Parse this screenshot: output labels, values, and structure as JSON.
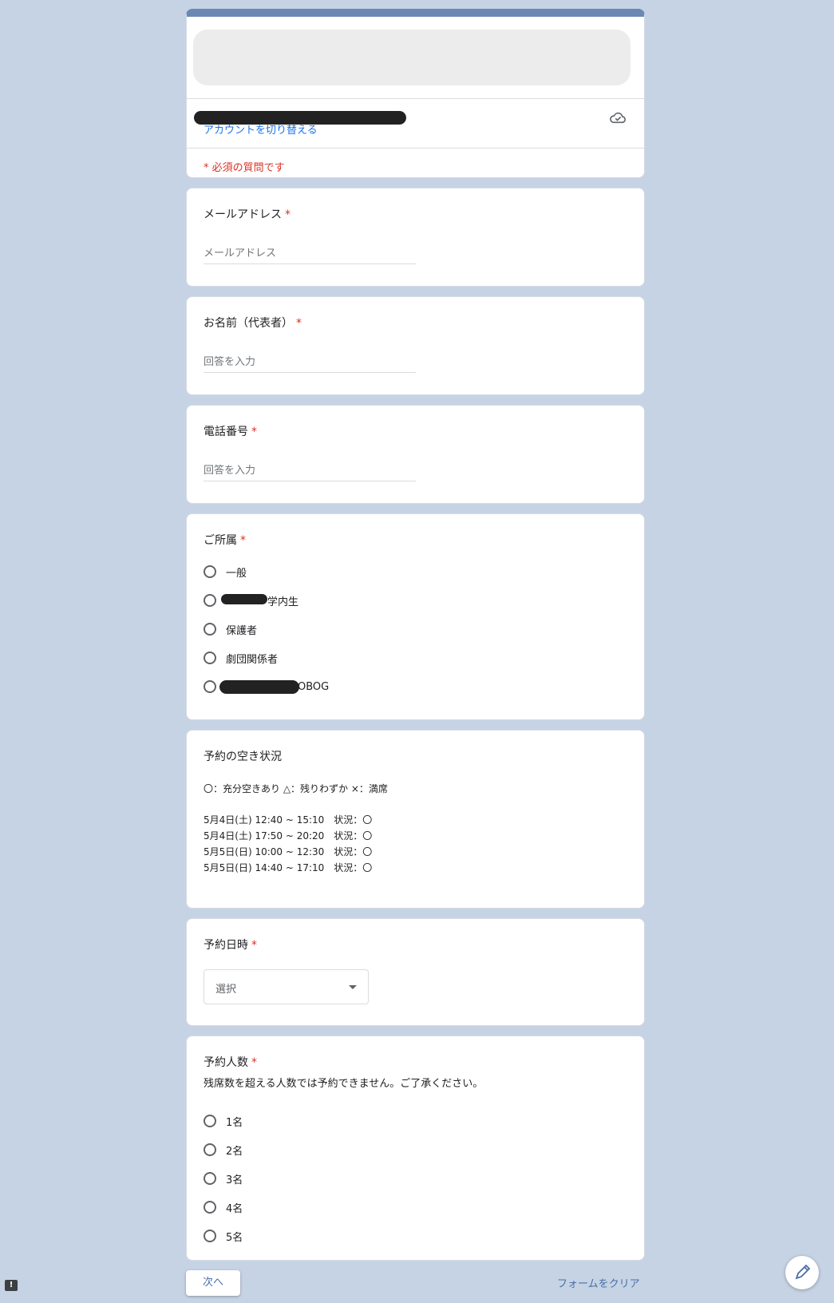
{
  "header": {
    "switch_account": "アカウントを切り替える",
    "required_note": "* 必須の質問です",
    "cloud_icon": "cloud-check-icon"
  },
  "email": {
    "title": "メールアドレス",
    "asterisk": "*",
    "placeholder": "メールアドレス"
  },
  "name": {
    "title": "お名前（代表者）",
    "asterisk": "*",
    "placeholder": "回答を入力"
  },
  "phone": {
    "title": "電話番号",
    "asterisk": "*",
    "placeholder": "回答を入力"
  },
  "affiliation": {
    "title": "ご所属",
    "asterisk": "*",
    "options": [
      "一般",
      "学内生",
      "保護者",
      "劇団関係者",
      "OBOG"
    ]
  },
  "availability": {
    "title": "予約の空き状況",
    "legend": "〇：充分空きあり  △：残りわずか  ×：満席",
    "lines": [
      "5月4日(土) 12:40 ~ 15:10　状況：〇",
      "5月4日(土) 17:50 ~ 20:20　状況：〇",
      "5月5日(日) 10:00 ~ 12:30　状況：〇",
      "5月5日(日) 14:40 ~ 17:10　状況：〇"
    ]
  },
  "datetime": {
    "title": "予約日時",
    "asterisk": "*",
    "selected": "選択"
  },
  "count": {
    "title": "予約人数",
    "asterisk": "*",
    "description": "残席数を超える人数では予約できません。ご了承ください。",
    "options": [
      "1名",
      "2名",
      "3名",
      "4名",
      "5名"
    ]
  },
  "footer": {
    "next": "次へ",
    "clear": "フォームをクリア",
    "feedback_icon": "!"
  },
  "colors": {
    "accent": "#6b88b4",
    "required": "#d93025",
    "link": "#1a73e8",
    "background": "#c6d3e4"
  }
}
